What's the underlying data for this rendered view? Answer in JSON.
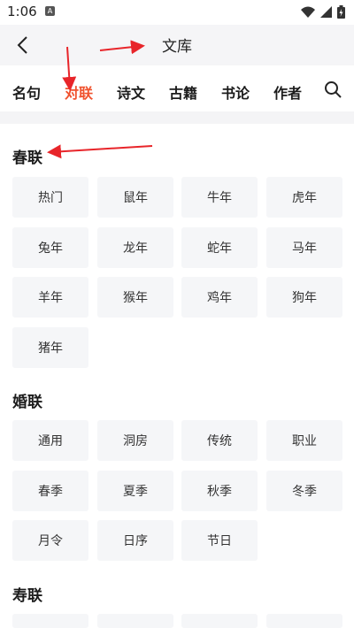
{
  "status_bar": {
    "time": "1:06",
    "notification_badge": "A"
  },
  "header": {
    "title": "文库"
  },
  "tabs": [
    {
      "label": "名句"
    },
    {
      "label": "对联",
      "active": true
    },
    {
      "label": "诗文"
    },
    {
      "label": "古籍"
    },
    {
      "label": "书论"
    },
    {
      "label": "作者"
    }
  ],
  "sections": [
    {
      "title": "春联",
      "items": [
        "热门",
        "鼠年",
        "牛年",
        "虎年",
        "兔年",
        "龙年",
        "蛇年",
        "马年",
        "羊年",
        "猴年",
        "鸡年",
        "狗年",
        "猪年"
      ]
    },
    {
      "title": "婚联",
      "items": [
        "通用",
        "洞房",
        "传统",
        "职业",
        "春季",
        "夏季",
        "秋季",
        "冬季",
        "月令",
        "日序",
        "节日"
      ]
    },
    {
      "title": "寿联",
      "items": []
    }
  ],
  "colors": {
    "accent": "#f0522e",
    "arrow": "#e8252a",
    "chip_bg": "#f5f6f8"
  },
  "icons": [
    "back-arrow-icon",
    "search-icon",
    "wifi-icon",
    "signal-icon",
    "battery-icon"
  ]
}
